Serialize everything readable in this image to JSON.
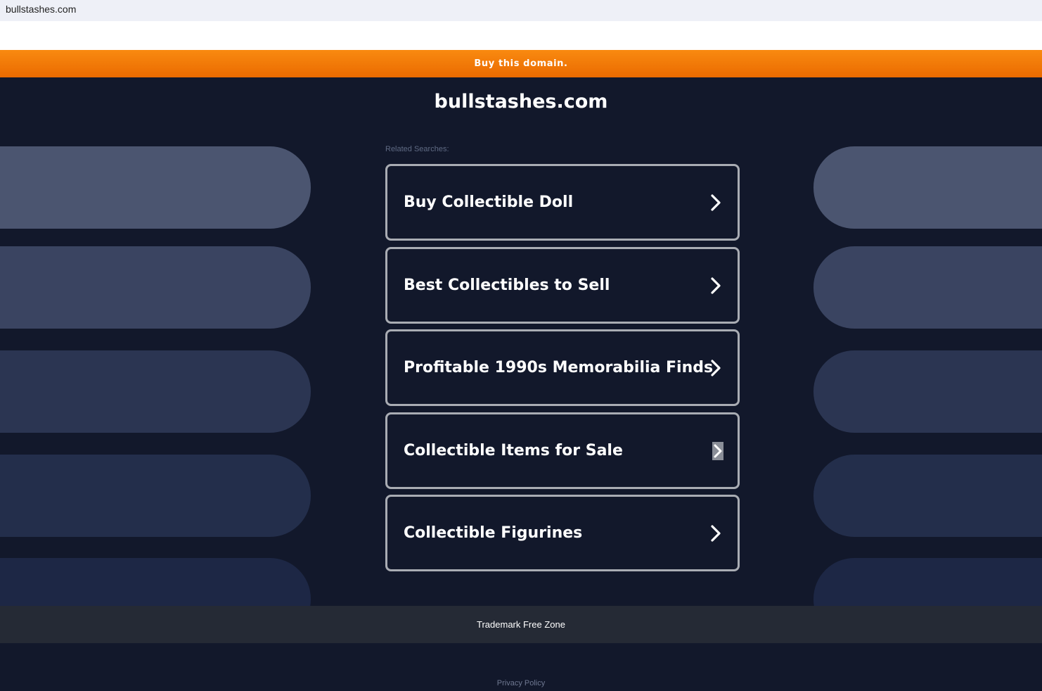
{
  "browser": {
    "tab_title": "bullstashes.com"
  },
  "banner": {
    "buy_label": "Buy this domain."
  },
  "page": {
    "domain_title": "bullstashes.com",
    "related_label": "Related Searches:"
  },
  "links": [
    {
      "label": "Buy Collectible Doll",
      "icon": "chevron-right-icon"
    },
    {
      "label": "Best Collectibles to Sell",
      "icon": "chevron-right-icon"
    },
    {
      "label": "Profitable 1990s Memorabilia Finds",
      "icon": "chevron-right-icon"
    },
    {
      "label": "Collectible Items for Sale",
      "icon": "chevron-right-icon"
    },
    {
      "label": "Collectible Figurines",
      "icon": "chevron-right-icon"
    }
  ],
  "footer": {
    "trademark": "Trademark Free Zone",
    "privacy": "Privacy Policy"
  },
  "colors": {
    "banner_orange": "#f47a08",
    "background": "#12182b",
    "link_border": "#a9acb3",
    "footer_bar": "#252a35"
  }
}
